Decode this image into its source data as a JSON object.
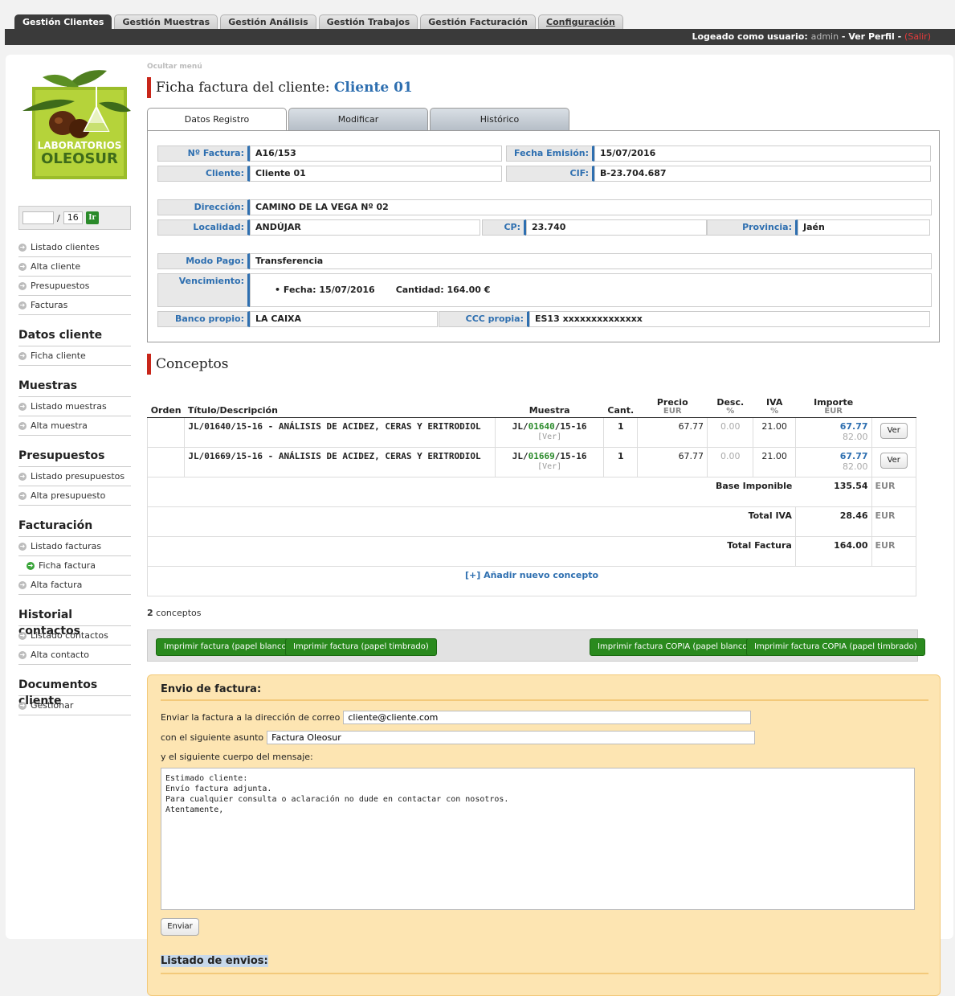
{
  "topnav": {
    "tabs": [
      {
        "label": "Gestión Clientes"
      },
      {
        "label": "Gestión Muestras"
      },
      {
        "label": "Gestión Análisis"
      },
      {
        "label": "Gestión Trabajos"
      },
      {
        "label": "Gestión Facturación"
      },
      {
        "label": "Configuración"
      }
    ],
    "login_prefix": "Logeado como usuario:",
    "username": "admin",
    "ver_perfil": "Ver Perfil",
    "salir": "(Salir)"
  },
  "sidebar": {
    "logo_line1": "LABORATORIOS",
    "logo_line2": "OLEOSUR",
    "pager": {
      "total": "16",
      "go": "Ir"
    },
    "clientes": [
      "Listado clientes",
      "Alta cliente",
      "Presupuestos",
      "Facturas"
    ],
    "groups": [
      {
        "title": "Datos cliente",
        "items": [
          "Ficha cliente"
        ]
      },
      {
        "title": "Muestras",
        "items": [
          "Listado muestras",
          "Alta muestra"
        ]
      },
      {
        "title": "Presupuestos",
        "items": [
          "Listado presupuestos",
          "Alta presupuesto"
        ]
      },
      {
        "title": "Facturación",
        "items": [
          "Listado facturas",
          "Ficha factura",
          "Alta factura"
        ]
      },
      {
        "title": "Historial contactos",
        "items": [
          "Listado contactos",
          "Alta contacto"
        ]
      },
      {
        "title": "Documentos cliente",
        "items": [
          "Gestionar"
        ]
      }
    ]
  },
  "main": {
    "ocultar": "Ocultar menú",
    "title_prefix": "Ficha factura del cliente:",
    "client_name": "Cliente 01",
    "form_tabs": [
      "Datos Registro",
      "Modificar",
      "Histórico"
    ],
    "fields": {
      "n_factura_label": "Nº Factura:",
      "n_factura": "A16/153",
      "fecha_emision_label": "Fecha Emisión:",
      "fecha_emision": "15/07/2016",
      "cliente_label": "Cliente:",
      "cliente": "Cliente 01",
      "cif_label": "CIF:",
      "cif": "B-23.704.687",
      "direccion_label": "Dirección:",
      "direccion": "CAMINO DE LA VEGA Nº 02",
      "localidad_label": "Localidad:",
      "localidad": "ANDÚJAR",
      "cp_label": "CP:",
      "cp": "23.740",
      "provincia_label": "Provincia:",
      "provincia": "Jaén",
      "modo_pago_label": "Modo Pago:",
      "modo_pago": "Transferencia",
      "vencimiento_label": "Vencimiento:",
      "venc_fecha": "Fecha: 15/07/2016",
      "venc_cantidad": "Cantidad: 164.00 €",
      "banco_label": "Banco propio:",
      "banco": "LA CAIXA",
      "ccc_label": "CCC propia:",
      "ccc": "ES13 xxxxxxxxxxxxxx"
    },
    "conceptos_title": "Conceptos",
    "table": {
      "headers": {
        "orden": "Orden",
        "titulo": "Título/Descripción",
        "muestra": "Muestra",
        "cant": "Cant.",
        "precio": "Precio",
        "precio_unit": "EUR",
        "desc": "Desc.",
        "desc_unit": "%",
        "iva": "IVA",
        "iva_unit": "%",
        "importe": "Importe",
        "importe_unit": "EUR"
      },
      "rows": [
        {
          "desc": "JL/01640/15-16 - ANÁLISIS DE ACIDEZ, CERAS Y ERITRODIOL",
          "m_pre": "JL/",
          "m_num": "01640",
          "m_post": "/15-16",
          "m_ver": "[Ver]",
          "cant": "1",
          "precio": "67.77",
          "descuento": "0.00",
          "iva": "21.00",
          "importe": "67.77",
          "importe_iva": "82.00",
          "btn": "Ver"
        },
        {
          "desc": "JL/01669/15-16 - ANÁLISIS DE ACIDEZ, CERAS Y ERITRODIOL",
          "m_pre": "JL/",
          "m_num": "01669",
          "m_post": "/15-16",
          "m_ver": "[Ver]",
          "cant": "1",
          "precio": "67.77",
          "descuento": "0.00",
          "iva": "21.00",
          "importe": "67.77",
          "importe_iva": "82.00",
          "btn": "Ver"
        }
      ],
      "base_label": "Base Imponible",
      "base": "135.54",
      "iva_label": "Total IVA",
      "iva_total": "28.46",
      "total_label": "Total Factura",
      "total": "164.00",
      "currency": "EUR",
      "add": "[+] Añadir nuevo concepto"
    },
    "count_num": "2",
    "count_text": "conceptos",
    "print_buttons": [
      "Imprimir factura (papel blanco)",
      "Imprimir factura (papel timbrado)",
      "Imprimir factura COPIA (papel blanco)",
      "Imprimir factura COPIA (papel timbrado)"
    ],
    "envio": {
      "title": "Envio de factura:",
      "email_label": "Enviar la factura a la dirección de correo",
      "email": "cliente@cliente.com",
      "asunto_label": "con el siguiente asunto",
      "asunto": "Factura Oleosur",
      "cuerpo_label": "y el siguiente cuerpo del mensaje:",
      "cuerpo": "Estimado cliente:\nEnvío factura adjunta.\nPara cualquier consulta o aclaración no dude en contactar con nosotros.\nAtentamente,",
      "enviar": "Enviar",
      "listado": "Listado de envios:"
    }
  }
}
